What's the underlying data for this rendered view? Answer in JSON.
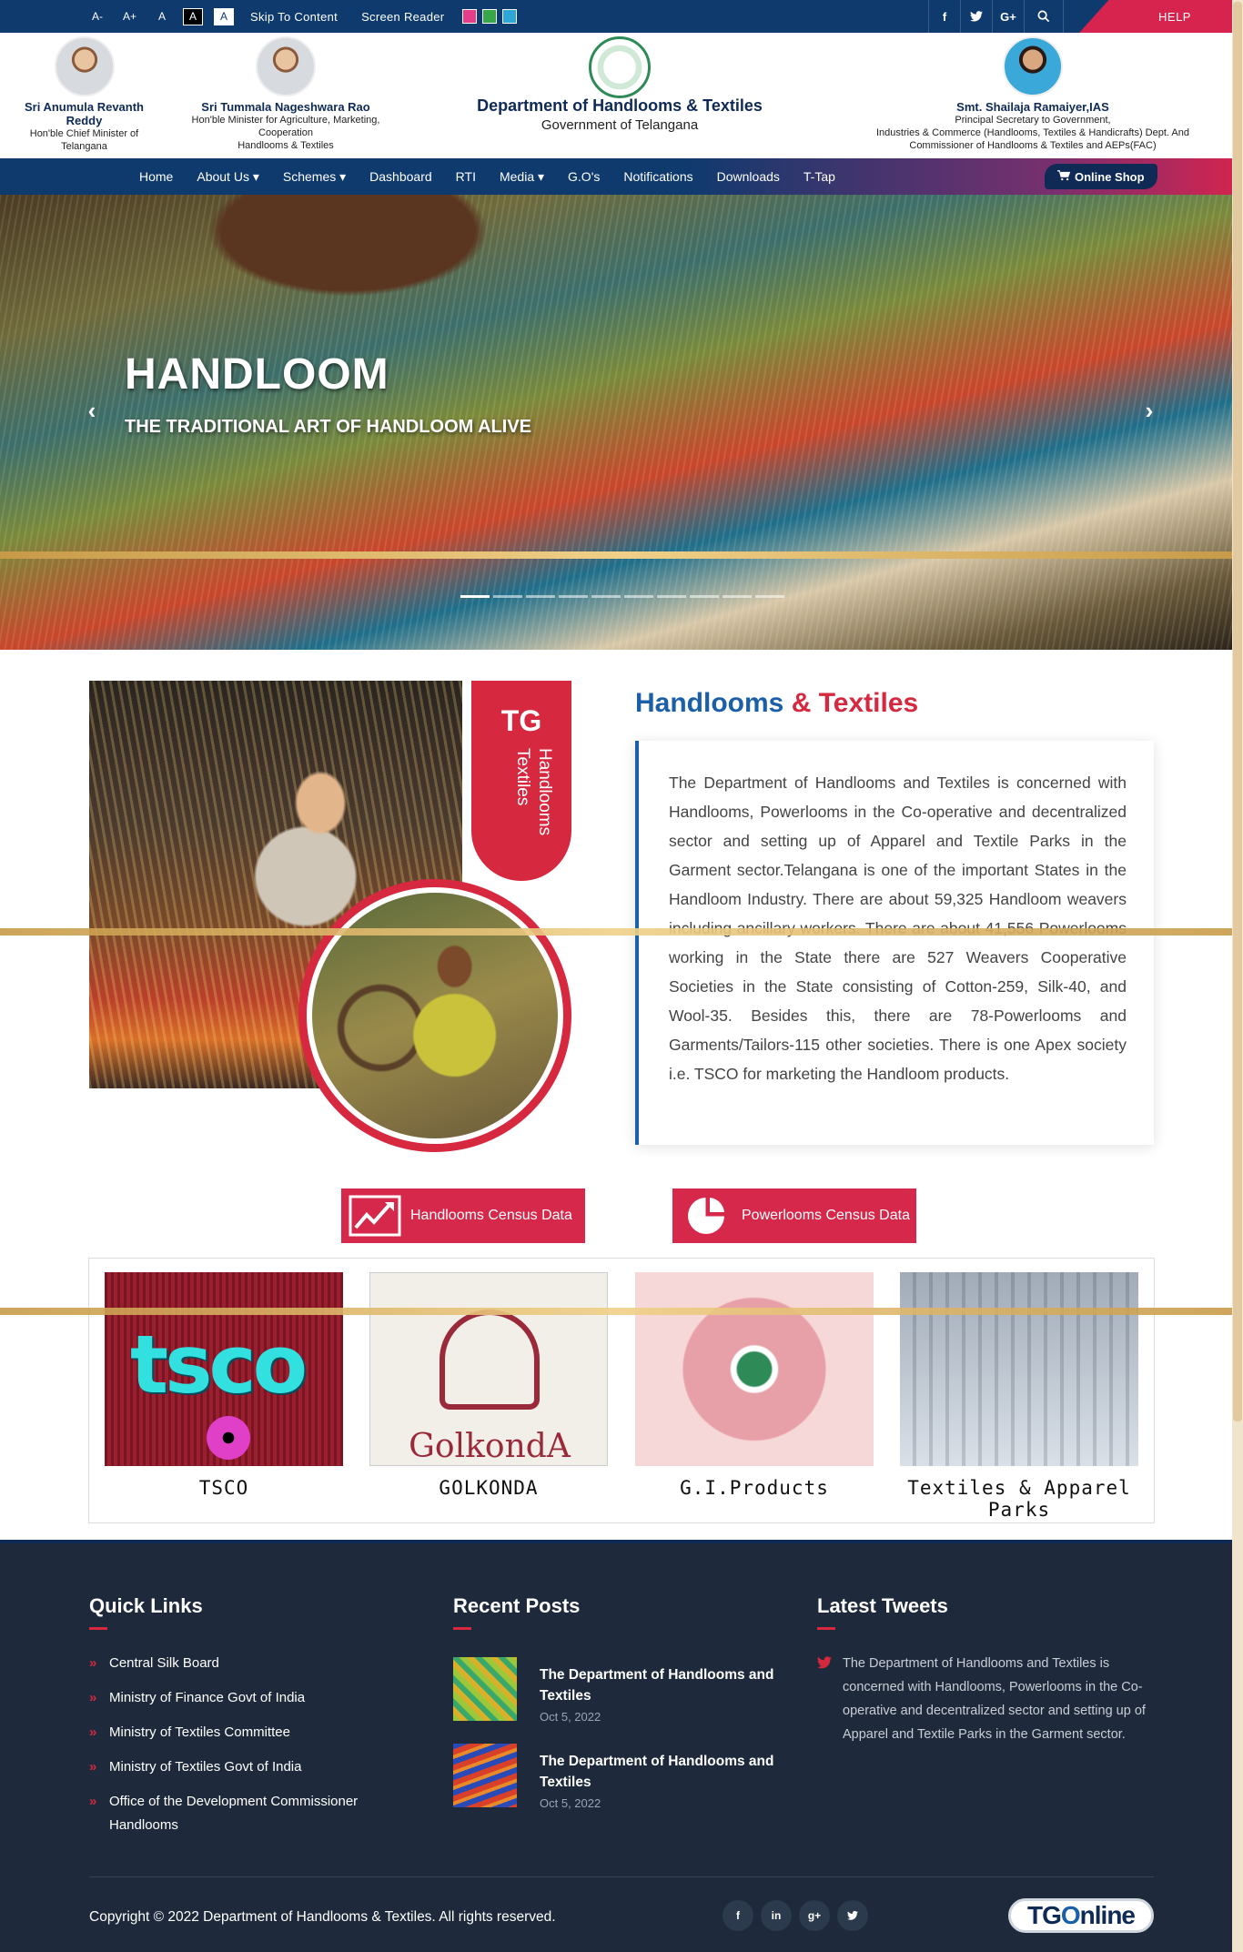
{
  "topbar": {
    "font_small": "A-",
    "font_large": "A+",
    "font_normal": "A",
    "contrast_dark": "A",
    "contrast_light": "A",
    "skip": "Skip To Content",
    "reader": "Screen Reader",
    "swatches": [
      "#e43d8c",
      "#37a84a",
      "#2fa7d6"
    ],
    "social": [
      "f",
      "t",
      "G+",
      "search"
    ],
    "help": "HELP"
  },
  "header": {
    "left1": {
      "name": "Sri Anumula Revanth Reddy",
      "desig": "Hon'ble Chief Minister of Telangana"
    },
    "left2": {
      "name": "Sri Tummala Nageshwara Rao",
      "desig": "Hon'ble Minister for Agriculture, Marketing, Cooperation",
      "desig2": "Handlooms & Textiles"
    },
    "dept_title": "Department of Handlooms & Textiles",
    "dept_sub": "Government of Telangana",
    "right": {
      "name": "Smt. Shailaja Ramaiyer,IAS",
      "desig1": "Principal Secretary to Government,",
      "desig2": "Industries & Commerce (Handlooms, Textiles & Handicrafts) Dept. And",
      "desig3": "Commissioner of Handlooms & Textiles and AEPs(FAC)"
    }
  },
  "nav": {
    "items": [
      "Home",
      "About Us ▾",
      "Schemes ▾",
      "Dashboard",
      "RTI",
      "Media ▾",
      "G.O's",
      "Notifications",
      "Downloads",
      "T-Tap"
    ],
    "shop": "Online Shop"
  },
  "hero": {
    "title": "HANDLOOM",
    "tagline": "THE TRADITIONAL ART OF HANDLOOM ALIVE",
    "slide_count": 10,
    "active_slide": 1
  },
  "about": {
    "badge_tg": "TG",
    "badge_line1": "Handlooms",
    "badge_line2": "Textiles",
    "title_a": "Handlooms",
    "title_b": "& Textiles",
    "body": "The Department of Handlooms and Textiles is concerned with Handlooms, Powerlooms in the Co-operative and decentralized sector and setting up of Apparel and Textile Parks in the Garment sector.Telangana is one of the important States in the Handloom Industry. There are about 59,325 Handloom weavers including ancillary workers. There are about 41,556 Powerlooms working in the State there are 527 Weavers Cooperative Societies in the State consisting of Cotton-259, Silk-40, and Wool-35. Besides this, there are 78-Powerlooms and Garments/Tailors-115 other societies. There is one Apex society i.e. TSCO for marketing the Handloom products."
  },
  "census": {
    "handlooms": "Handlooms Census Data",
    "powerlooms": "Powerlooms Census Data"
  },
  "gallery": {
    "tiles": [
      "TSCO",
      "GOLKONDA",
      "G.I.Products",
      "Textiles & Apparel Parks"
    ],
    "tsco_logo": "tsco",
    "golkonda_logo": "GolkondA"
  },
  "footer": {
    "quick_title": "Quick Links",
    "quick_links": [
      "Central Silk Board",
      "Ministry of Finance Govt of India",
      "Ministry of Textiles Committee",
      "Ministry of Textiles Govt of India",
      "Office of the Development Commissioner Handlooms"
    ],
    "posts_title": "Recent Posts",
    "posts": [
      {
        "title": "The Department of Handlooms and Textiles",
        "date": "Oct 5, 2022"
      },
      {
        "title": "The Department of Handlooms and Textiles",
        "date": "Oct 5, 2022"
      }
    ],
    "tweets_title": "Latest Tweets",
    "tweet": "The Department of Handlooms and Textiles is concerned with Handlooms, Powerlooms in the Co-operative and decentralized sector and setting up of Apparel and Textile Parks in the Garment sector.",
    "copyright": "Copyright © 2022 Department of Handlooms & Textiles. All rights reserved.",
    "social": [
      "f",
      "in",
      "g+",
      "t"
    ],
    "brand_a": "TG",
    "brand_b": "O",
    "brand_c": "nline"
  }
}
